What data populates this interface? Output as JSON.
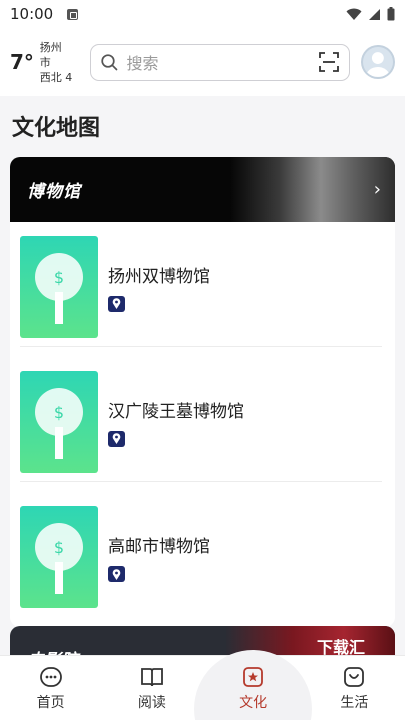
{
  "status_bar": {
    "time": "10:00"
  },
  "header": {
    "temperature": "7°",
    "city": "扬州市",
    "wind": "西北 4",
    "search_placeholder": "搜索"
  },
  "page_title": "文化地图",
  "museum_section": {
    "title": "博物馆",
    "items": [
      {
        "name": "扬州双博物馆"
      },
      {
        "name": "汉广陵王墓博物馆"
      },
      {
        "name": "高邮市博物馆"
      }
    ]
  },
  "cinema_section": {
    "title": "电影院"
  },
  "watermark": "下载汇",
  "bottom_nav": [
    {
      "label": "首页",
      "icon": "home-icon"
    },
    {
      "label": "阅读",
      "icon": "book-icon"
    },
    {
      "label": "文化",
      "icon": "culture-icon",
      "active": true
    },
    {
      "label": "生活",
      "icon": "life-icon"
    }
  ],
  "colors": {
    "accent": "#b53a2c",
    "thumb_top": "#2ed6b4",
    "thumb_bottom": "#5ce38c",
    "pin": "#1e2a6b"
  }
}
